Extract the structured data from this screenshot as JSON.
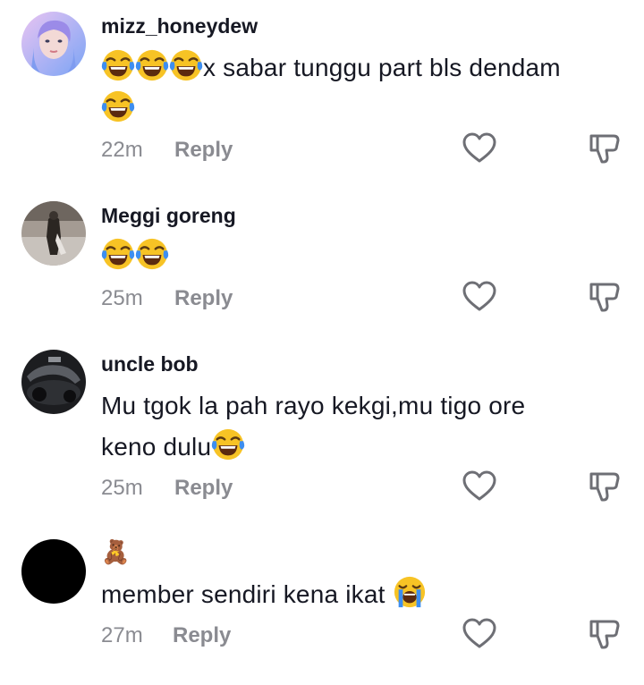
{
  "comments": [
    {
      "username": "mizz_honeydew",
      "text_line1": "x sabar tunggu part bls dendam",
      "time": "22m",
      "reply_label": "Reply"
    },
    {
      "username": "Meggi goreng",
      "time": "25m",
      "reply_label": "Reply"
    },
    {
      "username": "uncle bob",
      "text_line1": "Mu tgok la pah rayo kekgi,mu tigo ore",
      "text_line2": "keno dulu",
      "time": "25m",
      "reply_label": "Reply"
    },
    {
      "username_emoji": "🧸",
      "text_line1": "member sendiri kena ikat",
      "time": "27m",
      "reply_label": "Reply"
    }
  ],
  "icons": {
    "laughing": "face-with-tears-of-joy-icon",
    "crying": "loudly-crying-face-icon",
    "like": "heart-outline-icon",
    "dislike": "thumbs-down-outline-icon"
  },
  "colors": {
    "text": "#161823",
    "muted": "#8a8b91",
    "icon": "#6e6f75"
  }
}
